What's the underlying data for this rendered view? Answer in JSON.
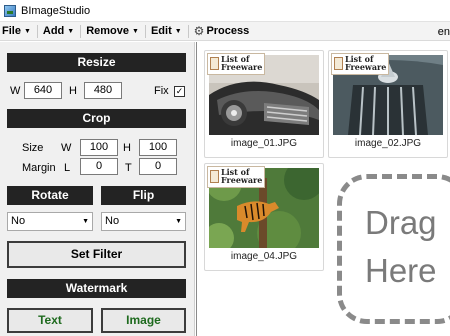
{
  "window": {
    "title": "BImageStudio"
  },
  "menubar": {
    "items": [
      {
        "label": "File"
      },
      {
        "label": "Add"
      },
      {
        "label": "Remove"
      },
      {
        "label": "Edit"
      }
    ],
    "process_label": "Process",
    "right_text": "en"
  },
  "resize": {
    "header": "Resize",
    "w_label": "W",
    "w_value": "640",
    "h_label": "H",
    "h_value": "480",
    "fix_label": "Fix",
    "fix_checked": true
  },
  "crop": {
    "header": "Crop",
    "size_label": "Size",
    "w_label": "W",
    "w_value": "100",
    "h_label": "H",
    "h_value": "100",
    "margin_label": "Margin",
    "l_label": "L",
    "l_value": "0",
    "t_label": "T",
    "t_value": "0"
  },
  "rotate": {
    "header": "Rotate",
    "value": "No"
  },
  "flip": {
    "header": "Flip",
    "value": "No"
  },
  "filter": {
    "button_label": "Set Filter"
  },
  "watermark": {
    "header": "Watermark",
    "text_button": "Text",
    "image_button": "Image"
  },
  "thumbnails": [
    {
      "name": "image_01.JPG",
      "logo_line1": "List of",
      "logo_line2": "Freeware"
    },
    {
      "name": "image_02.JPG",
      "logo_line1": "List of",
      "logo_line2": "Freeware"
    },
    {
      "name": "image_04.JPG",
      "logo_line1": "List of",
      "logo_line2": "Freeware"
    }
  ],
  "dropzone": {
    "line1": "Drag",
    "line2": "Here"
  }
}
